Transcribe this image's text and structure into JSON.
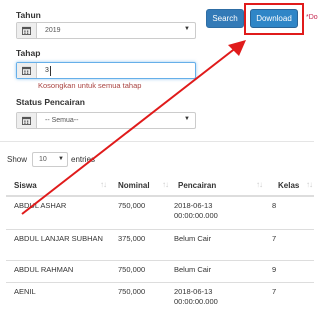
{
  "filters": {
    "tahun": {
      "label": "Tahun",
      "value": "2019"
    },
    "tahap": {
      "label": "Tahap",
      "value": "3",
      "error": "Kosongkan untuk semua tahap"
    },
    "status": {
      "label": "Status Pencairan",
      "value": "-- Semua--"
    }
  },
  "actions": {
    "search_label": "Search",
    "download_label": "Download",
    "side_text": "*Do"
  },
  "table_controls": {
    "show_label": "Show",
    "entries_value": "10",
    "entries_label": "entries"
  },
  "table": {
    "headers": [
      "Siswa",
      "Nominal",
      "Pencairan",
      "Kelas"
    ],
    "rows": [
      {
        "siswa": "ABDUL ASHAR",
        "nominal": "750,000",
        "pencairan": "2018-06-13 00:00:00.000",
        "kelas": "8"
      },
      {
        "siswa": "ABDUL LANJAR SUBHAN",
        "nominal": "375,000",
        "pencairan": "Belum Cair",
        "kelas": "7"
      },
      {
        "siswa": "ABDUL RAHMAN",
        "nominal": "750,000",
        "pencairan": "Belum Cair",
        "kelas": "9"
      },
      {
        "siswa": "AENIL",
        "nominal": "750,000",
        "pencairan": "2018-06-13 00:00:00.000",
        "kelas": "7"
      }
    ]
  },
  "annotation": {
    "color": "#e01b1b"
  },
  "colors": {
    "primary": "#337ab7",
    "error": "#a94442",
    "highlight": "#e01b1b"
  }
}
